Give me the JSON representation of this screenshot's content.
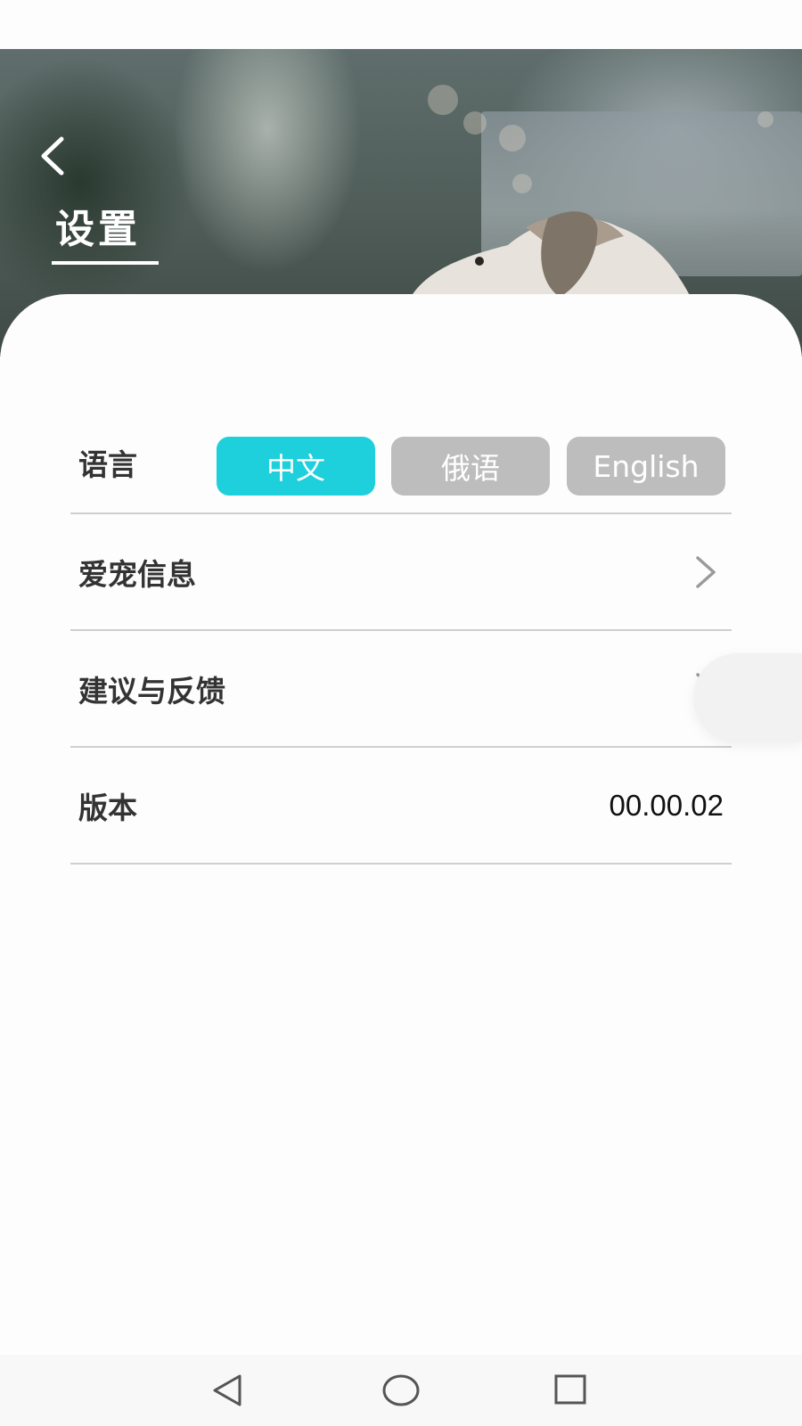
{
  "header": {
    "title": "设置",
    "back_icon": "chevron-left-icon"
  },
  "settings": {
    "language": {
      "label": "语言",
      "options": [
        {
          "label": "中文",
          "selected": true
        },
        {
          "label": "俄语",
          "selected": false
        },
        {
          "label": "English",
          "selected": false
        }
      ]
    },
    "pet_info": {
      "label": "爱宠信息",
      "icon": "chevron-right-icon"
    },
    "feedback": {
      "label": "建议与反馈",
      "icon": "chevron-right-icon"
    },
    "version": {
      "label": "版本",
      "value": "00.00.02"
    }
  },
  "colors": {
    "accent": "#1ed0db",
    "inactive_button": "#bdbdbd",
    "divider": "#cfcfcf",
    "label_text": "#333333"
  },
  "nav_bar": {
    "buttons": [
      "back-triangle-icon",
      "home-circle-icon",
      "recents-square-icon"
    ]
  }
}
